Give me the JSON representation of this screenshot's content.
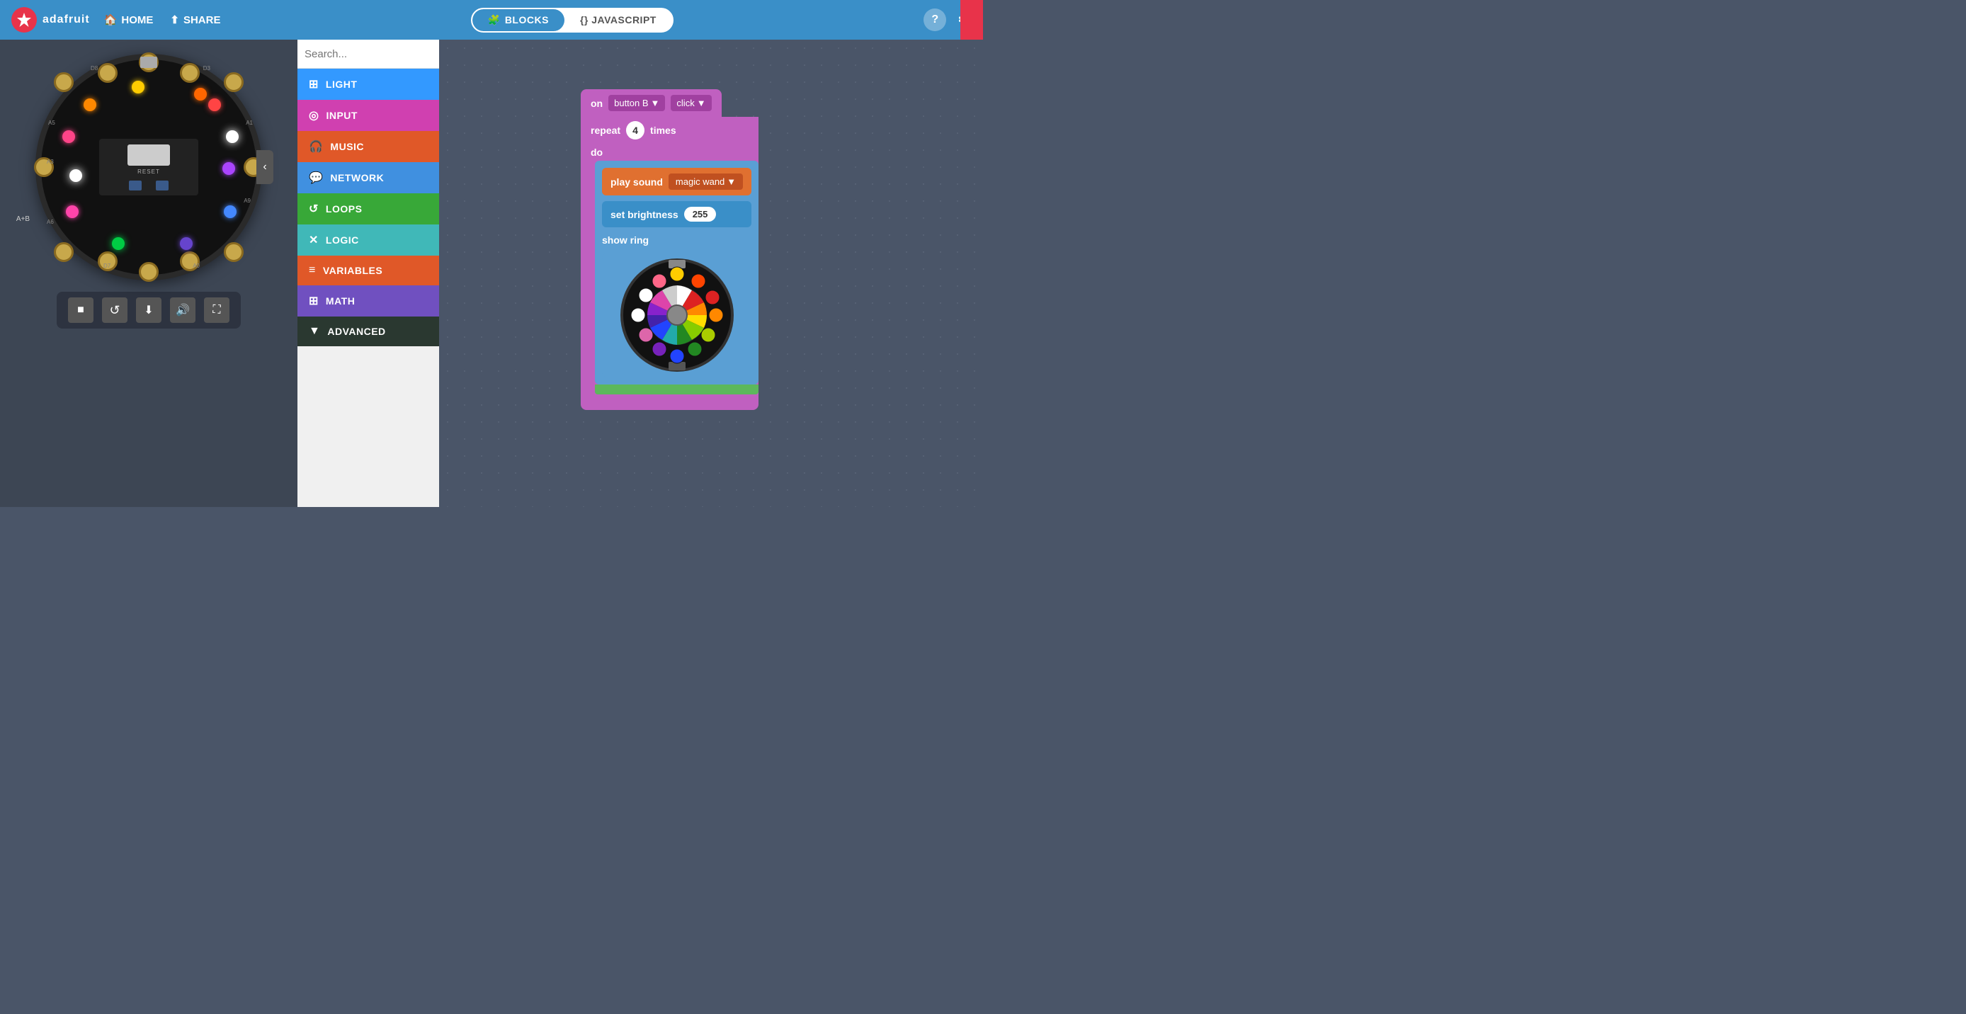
{
  "header": {
    "logo": "adafruit",
    "nav": [
      {
        "id": "home",
        "icon": "🏠",
        "label": "HOME"
      },
      {
        "id": "share",
        "icon": "⇧",
        "label": "SHARE"
      }
    ],
    "mode_blocks": "BLOCKS",
    "mode_javascript": "{} JAVASCRIPT",
    "help_icon": "?",
    "settings_icon": "⚙"
  },
  "search": {
    "placeholder": "Search..."
  },
  "categories": [
    {
      "id": "light",
      "label": "LIGHT",
      "color": "#3399ff",
      "icon": "⬛"
    },
    {
      "id": "input",
      "label": "INPUT",
      "color": "#e040c0",
      "icon": "◎"
    },
    {
      "id": "music",
      "label": "MUSIC",
      "color": "#e05020",
      "icon": "🎧"
    },
    {
      "id": "network",
      "label": "NETWORK",
      "color": "#4090e0",
      "icon": "💬"
    },
    {
      "id": "loops",
      "label": "LOOPS",
      "color": "#40b040",
      "icon": "↺"
    },
    {
      "id": "logic",
      "label": "LOGIC",
      "color": "#40c0c0",
      "icon": "✕"
    },
    {
      "id": "variables",
      "label": "VARIABLES",
      "color": "#e06020",
      "icon": "≡"
    },
    {
      "id": "math",
      "label": "MATH",
      "color": "#8060c0",
      "icon": "⊞"
    },
    {
      "id": "advanced",
      "label": "ADVANCED",
      "color": "#2d3a2d",
      "icon": "▼"
    }
  ],
  "blocks": {
    "on_event": "on",
    "button_b": "button B",
    "click": "click",
    "repeat": "repeat",
    "repeat_times": "times",
    "repeat_count": "4",
    "do_label": "do",
    "play_sound": "play sound",
    "magic_wand": "magic wand",
    "set_brightness": "set brightness",
    "brightness_val": "255",
    "show_ring": "show ring"
  },
  "controls": [
    {
      "id": "stop",
      "icon": "■"
    },
    {
      "id": "refresh",
      "icon": "↺"
    },
    {
      "id": "download",
      "icon": "⬇"
    },
    {
      "id": "sound",
      "icon": "🔊"
    },
    {
      "id": "fullscreen",
      "icon": "⛶"
    }
  ]
}
